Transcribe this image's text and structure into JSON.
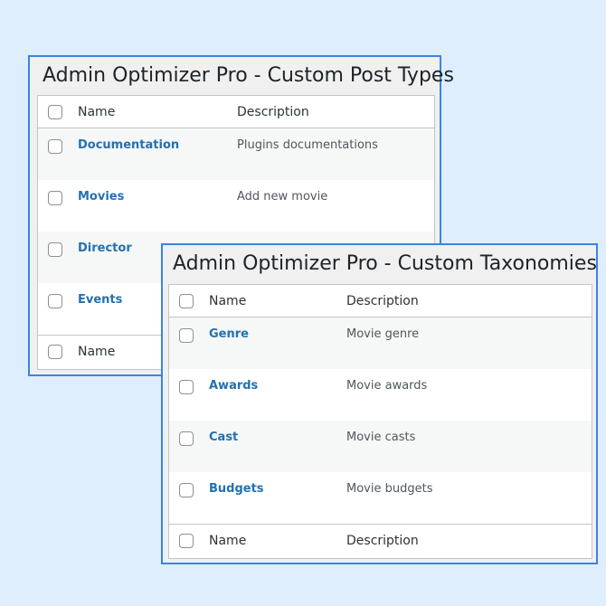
{
  "post_types_panel": {
    "title": "Admin Optimizer Pro - Custom Post Types",
    "columns": {
      "name": "Name",
      "description": "Description"
    },
    "rows": [
      {
        "name": "Documentation",
        "description": "Plugins documentations"
      },
      {
        "name": "Movies",
        "description": "Add new movie"
      },
      {
        "name": "Director",
        "description": ""
      },
      {
        "name": "Events",
        "description": ""
      }
    ],
    "footer": {
      "name": "Name",
      "description": ""
    }
  },
  "taxonomies_panel": {
    "title": "Admin Optimizer Pro - Custom Taxonomies",
    "columns": {
      "name": "Name",
      "description": "Description"
    },
    "rows": [
      {
        "name": "Genre",
        "description": "Movie genre"
      },
      {
        "name": "Awards",
        "description": "Movie awards"
      },
      {
        "name": "Cast",
        "description": "Movie casts"
      },
      {
        "name": "Budgets",
        "description": "Movie budgets"
      }
    ],
    "footer": {
      "name": "Name",
      "description": "Description"
    }
  },
  "colors": {
    "background": "#dfeefc",
    "panel_border": "#3b82e8",
    "link": "#2271b1"
  }
}
